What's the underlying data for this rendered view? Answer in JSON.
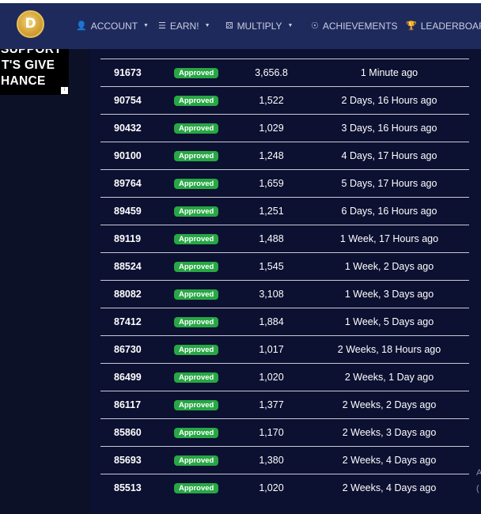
{
  "nav": {
    "items": [
      {
        "icon": "user-icon",
        "glyph": "👤",
        "label": "ACCOUNT",
        "caret": true
      },
      {
        "icon": "coins-icon",
        "glyph": "☰",
        "label": "EARN!",
        "caret": true
      },
      {
        "icon": "dice-icon",
        "glyph": "⚄",
        "label": "MULTIPLY",
        "caret": true
      },
      {
        "icon": "medal-icon",
        "glyph": "☉",
        "label": "ACHIEVEMENTS",
        "caret": false
      },
      {
        "icon": "trophy-icon",
        "glyph": "🏆",
        "label": "LEADERBOARDS",
        "caret": false
      }
    ]
  },
  "logo": {
    "glyph": "D"
  },
  "ad": {
    "lines": [
      "SUPPORT",
      "T'S GIVE",
      "HANCE"
    ],
    "badge": "i"
  },
  "colors": {
    "status_approved": "#28a745",
    "navbar": "#1f2a5c",
    "panel": "#0c1031"
  },
  "rows": [
    {
      "id": "91673",
      "status": "Approved",
      "amount": "3,656.8",
      "time": "1 Minute ago"
    },
    {
      "id": "90754",
      "status": "Approved",
      "amount": "1,522",
      "time": "2 Days, 16 Hours ago"
    },
    {
      "id": "90432",
      "status": "Approved",
      "amount": "1,029",
      "time": "3 Days, 16 Hours ago"
    },
    {
      "id": "90100",
      "status": "Approved",
      "amount": "1,248",
      "time": "4 Days, 17 Hours ago"
    },
    {
      "id": "89764",
      "status": "Approved",
      "amount": "1,659",
      "time": "5 Days, 17 Hours ago"
    },
    {
      "id": "89459",
      "status": "Approved",
      "amount": "1,251",
      "time": "6 Days, 16 Hours ago"
    },
    {
      "id": "89119",
      "status": "Approved",
      "amount": "1,488",
      "time": "1 Week, 17 Hours ago"
    },
    {
      "id": "88524",
      "status": "Approved",
      "amount": "1,545",
      "time": "1 Week, 2 Days ago"
    },
    {
      "id": "88082",
      "status": "Approved",
      "amount": "3,108",
      "time": "1 Week, 3 Days ago"
    },
    {
      "id": "87412",
      "status": "Approved",
      "amount": "1,884",
      "time": "1 Week, 5 Days ago"
    },
    {
      "id": "86730",
      "status": "Approved",
      "amount": "1,017",
      "time": "2 Weeks, 18 Hours ago"
    },
    {
      "id": "86499",
      "status": "Approved",
      "amount": "1,020",
      "time": "2 Weeks, 1 Day ago"
    },
    {
      "id": "86117",
      "status": "Approved",
      "amount": "1,377",
      "time": "2 Weeks, 2 Days ago"
    },
    {
      "id": "85860",
      "status": "Approved",
      "amount": "1,170",
      "time": "2 Weeks, 3 Days ago"
    },
    {
      "id": "85693",
      "status": "Approved",
      "amount": "1,380",
      "time": "2 Weeks, 4 Days ago"
    },
    {
      "id": "85513",
      "status": "Approved",
      "amount": "1,020",
      "time": "2 Weeks, 4 Days ago"
    }
  ],
  "edge_text": [
    "A",
    "("
  ]
}
